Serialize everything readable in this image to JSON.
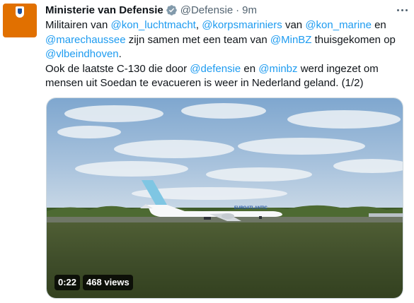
{
  "account": {
    "name": "Ministerie van Defensie",
    "handle": "@Defensie",
    "separator": "·",
    "time": "9m",
    "avatar_color": "#e17000"
  },
  "icons": {
    "avatar": "netherlands-coat-of-arms-icon",
    "verified": "verified-badge-icon",
    "more": "more-options-icon"
  },
  "colors": {
    "link": "#1d9bf0",
    "text": "#0f1419",
    "secondary": "#536471",
    "verified": "#829aab"
  },
  "tweet": {
    "l1": {
      "t1": "Militairen van ",
      "m1": "@kon_luchtmacht",
      "t2": ", ",
      "m2": "@korpsmariniers",
      "t3": " van ",
      "m3": "@kon_marine",
      "t4": " en"
    },
    "l2": {
      "m1": "@marechaussee",
      "t1": " zijn samen met een team van ",
      "m2": "@MinBZ",
      "t2": " thuisgekomen op"
    },
    "l3": {
      "m1": "@vlbeindhoven",
      "t1": "."
    },
    "l4": {
      "t1": "Ook de laatste C-130 die door ",
      "m1": "@defensie",
      "t2": " en ",
      "m2": "@minbz",
      "t3": " werd ingezet om"
    },
    "l5": {
      "t1": "mensen uit Soedan te evacueren is weer in Nederland geland. (1/2)"
    }
  },
  "media": {
    "aircraft_livery": "EUROATLANTIC",
    "duration": "0:22",
    "views": "468 views"
  }
}
